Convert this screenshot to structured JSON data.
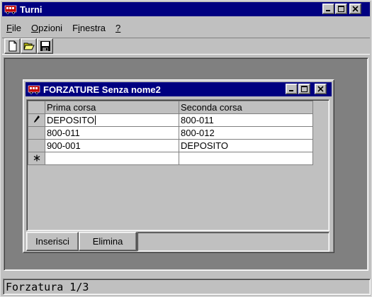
{
  "main_window": {
    "title": "Turni",
    "icon": "bus-icon",
    "controls": [
      "minimize-icon",
      "maximize-icon",
      "close-icon"
    ]
  },
  "menu": {
    "items": [
      {
        "label": "File",
        "accel_index": 0
      },
      {
        "label": "Opzioni",
        "accel_index": 0
      },
      {
        "label": "Finestra",
        "accel_index": 1
      },
      {
        "label": "?",
        "accel_index": 0
      }
    ]
  },
  "toolbar": {
    "buttons": [
      {
        "name": "new-document-icon"
      },
      {
        "name": "open-folder-icon"
      },
      {
        "name": "save-disk-icon"
      }
    ]
  },
  "child_window": {
    "title": "FORZATURE Senza nome2",
    "icon": "bus-icon",
    "grid": {
      "columns": [
        "Prima corsa",
        "Seconda corsa"
      ],
      "rows": [
        {
          "indicator": "pencil-icon",
          "cells": [
            "DEPOSITO",
            "800-011"
          ]
        },
        {
          "indicator": "",
          "cells": [
            "800-011",
            "800-012"
          ]
        },
        {
          "indicator": "",
          "cells": [
            "900-001",
            "DEPOSITO"
          ]
        },
        {
          "indicator": "new-row-icon",
          "cells": [
            "",
            ""
          ]
        }
      ]
    },
    "buttons": {
      "insert_label": "Inserisci",
      "delete_label": "Elimina"
    }
  },
  "statusbar": {
    "text": "Forzatura 1/3"
  }
}
